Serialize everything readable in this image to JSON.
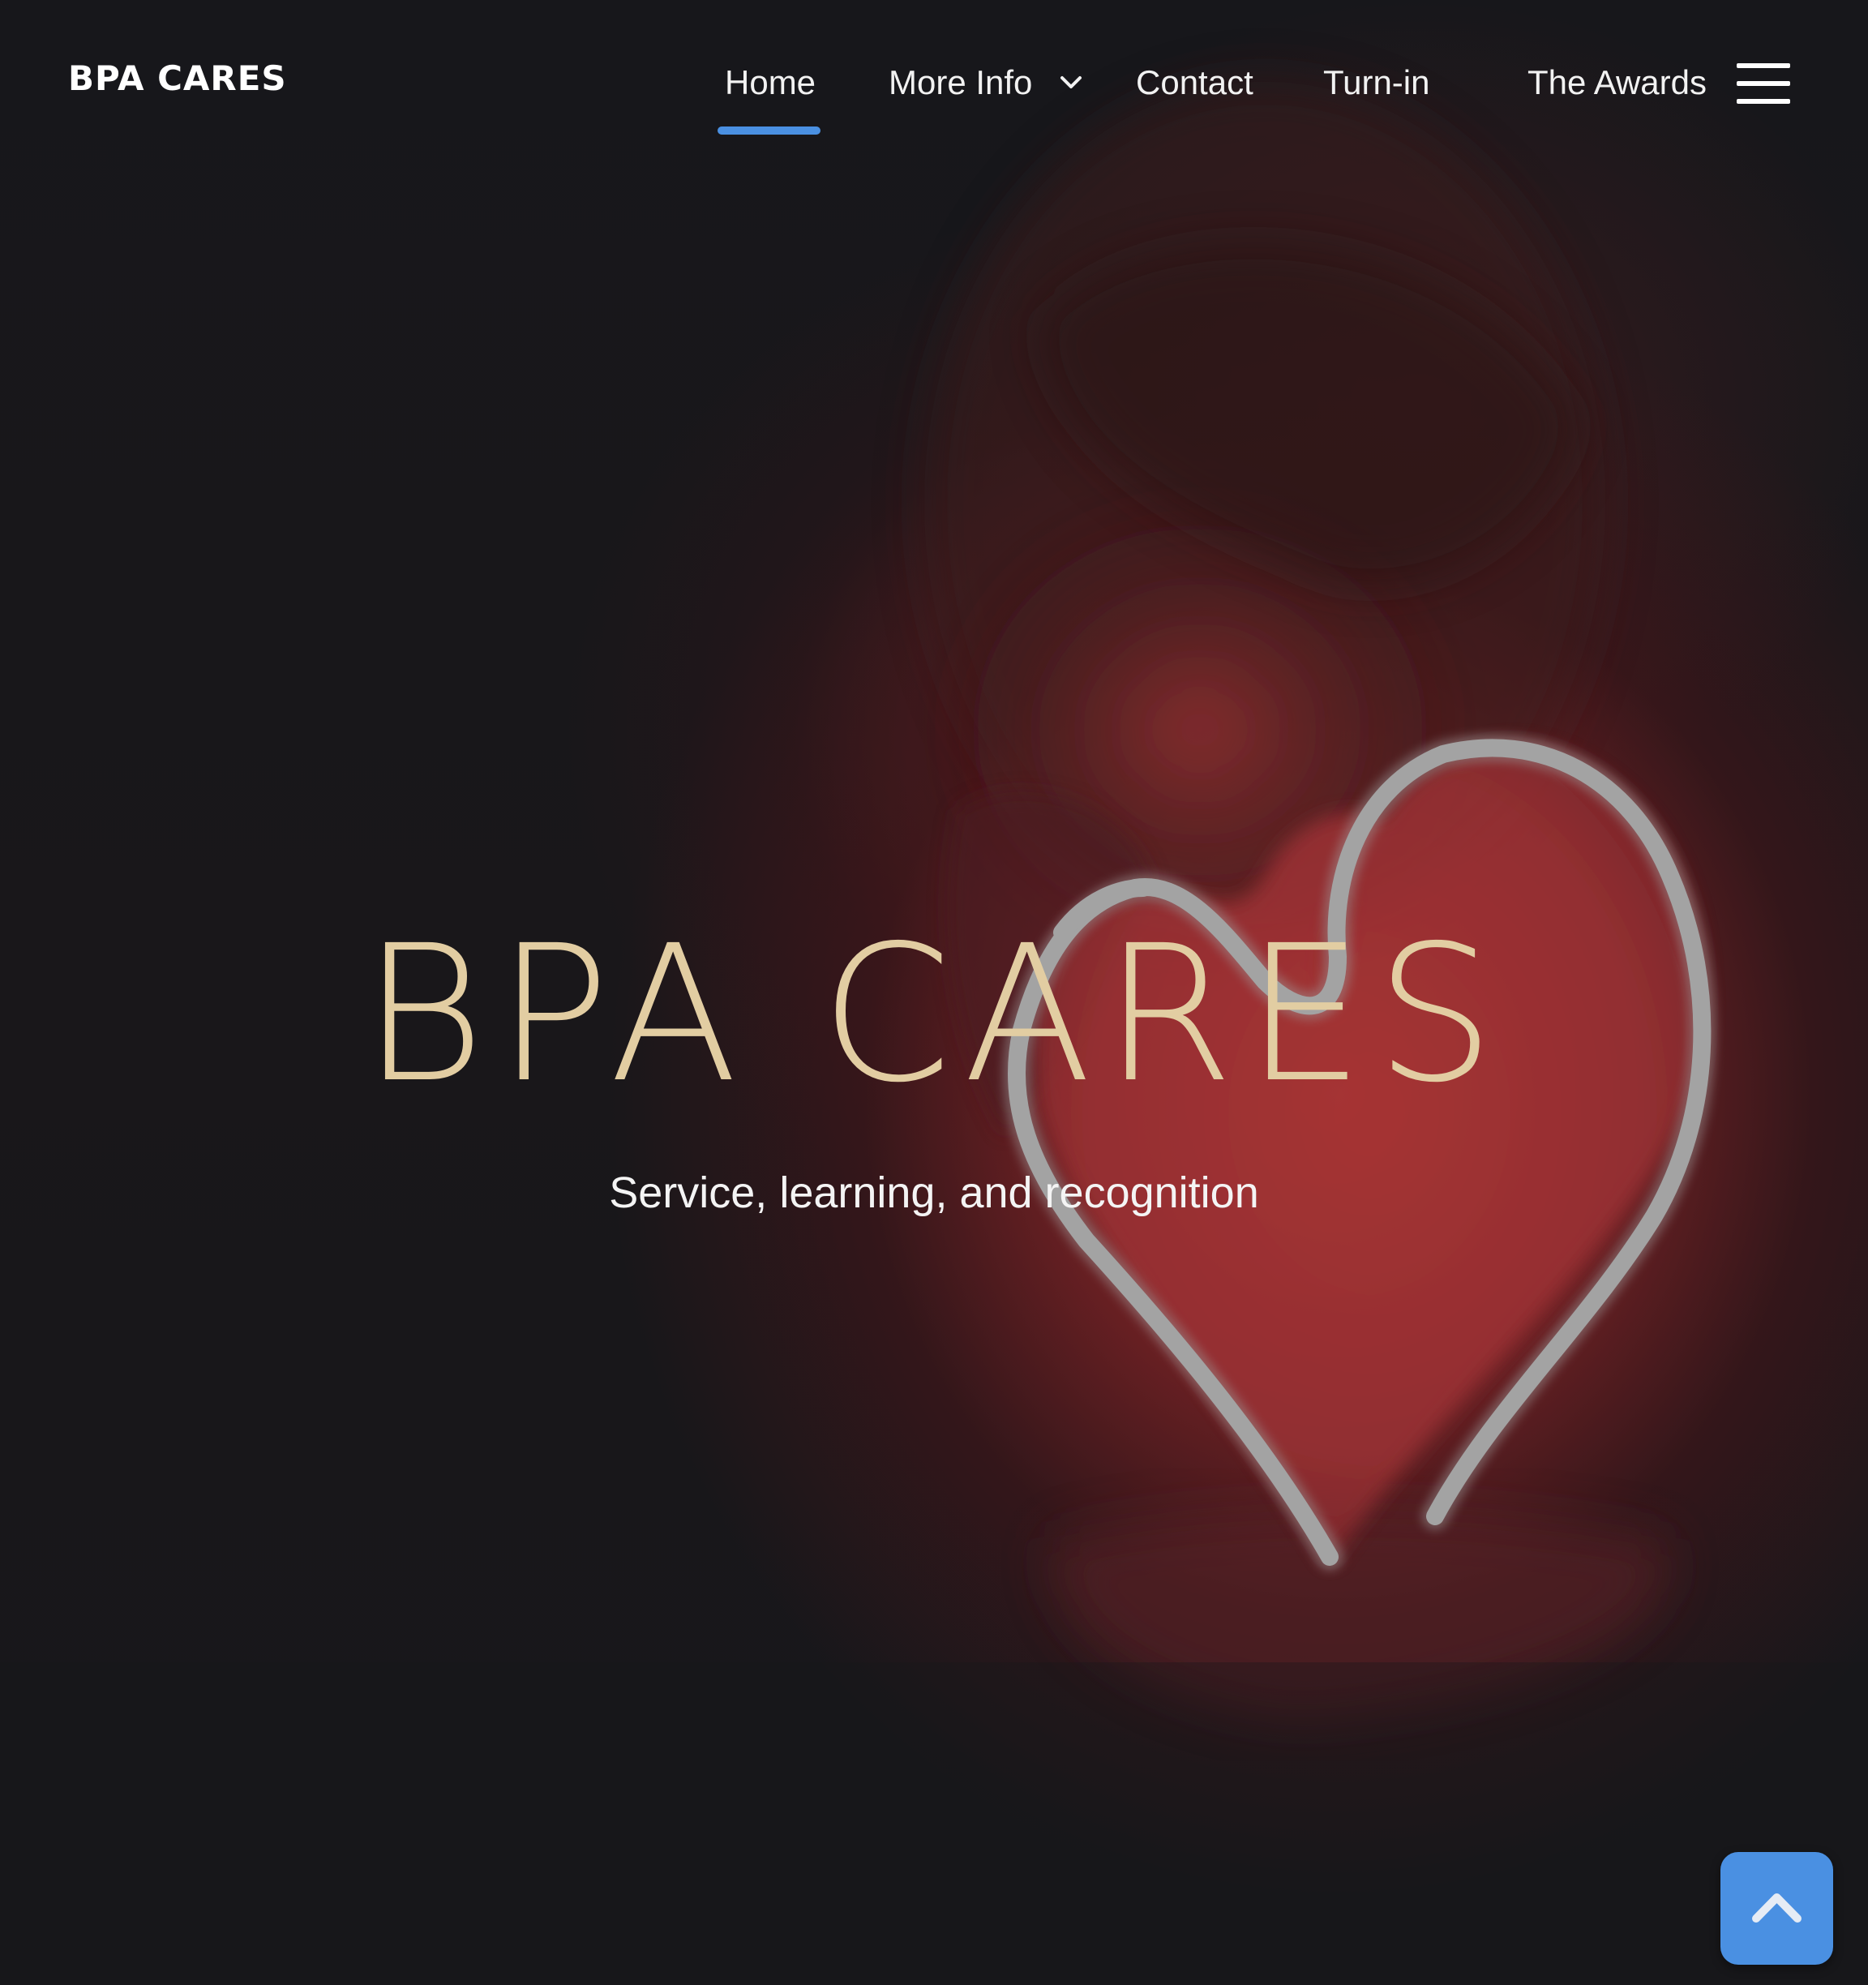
{
  "nav": {
    "brand": "BPA CARES",
    "items": [
      {
        "label": "Home",
        "active": true
      },
      {
        "label": "More Info",
        "has_dropdown": true
      },
      {
        "label": "Contact"
      },
      {
        "label": "Turn-in"
      },
      {
        "label": "The Awards"
      }
    ],
    "menu_icon": "hamburger-menu-icon",
    "active_underline_color": "#4a90e2"
  },
  "hero": {
    "title": "BPA CARES",
    "subtitle": "Service, learning, and recognition",
    "title_color": "#e2cda2",
    "background_image": "person-holding-glowing-neon-heart"
  },
  "back_to_top": {
    "icon": "chevron-up-icon",
    "color": "#4a90e2"
  }
}
